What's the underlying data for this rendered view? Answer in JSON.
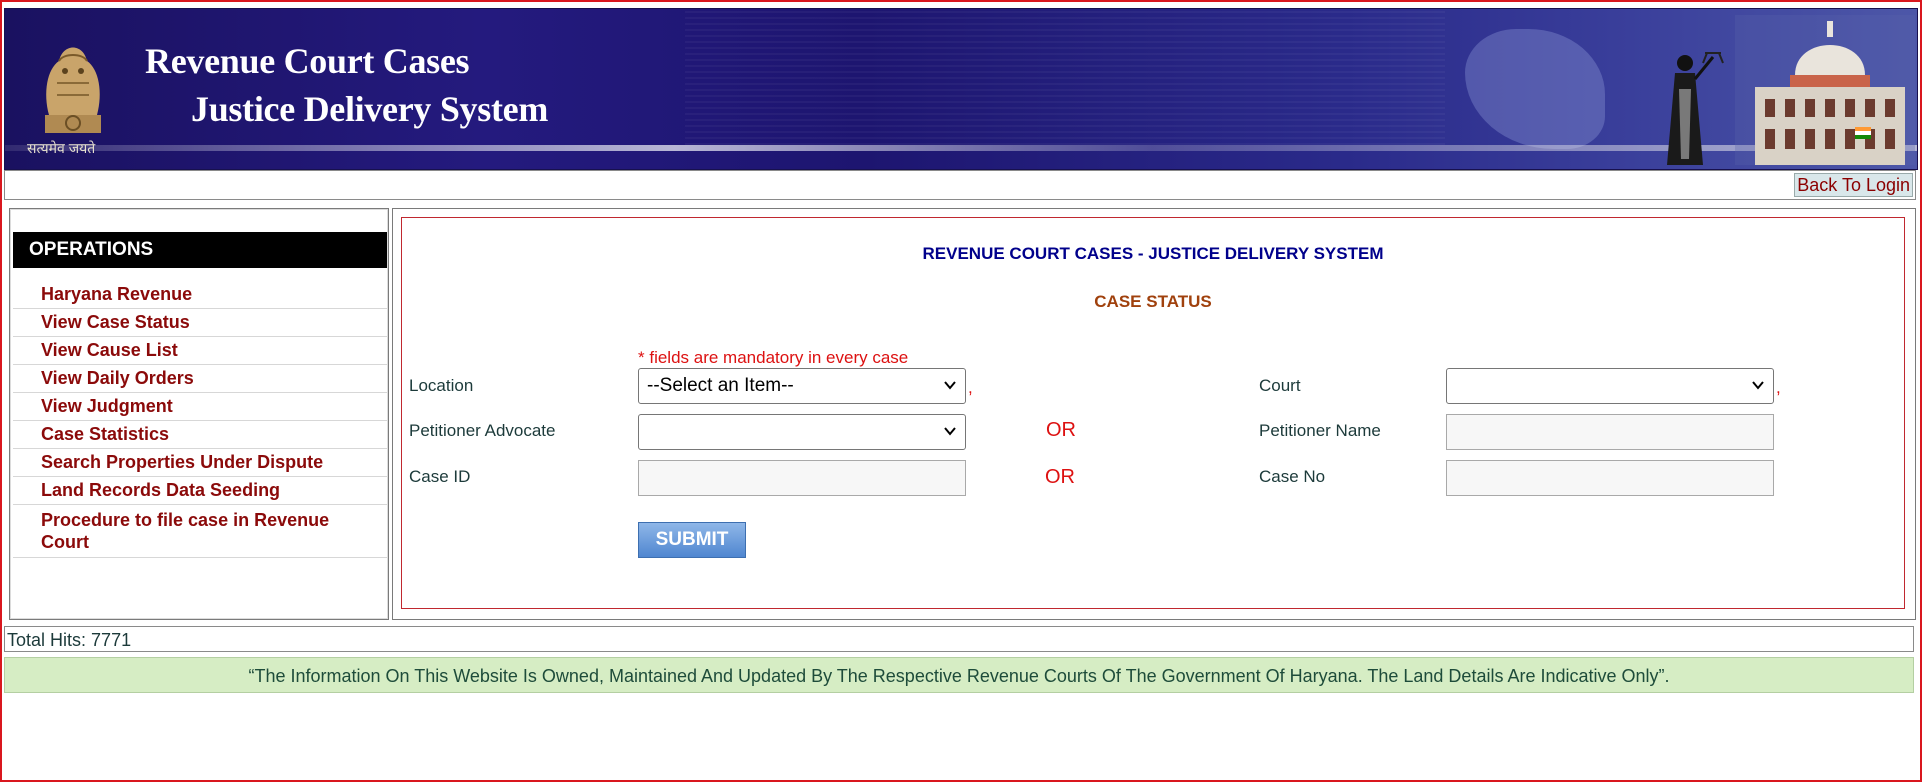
{
  "banner": {
    "title_line1": "Revenue Court Cases",
    "title_line2": "Justice Delivery System",
    "emblem_caption": "सत्यमेव जयते",
    "icons": [
      "national-emblem-icon",
      "justice-statue-icon",
      "court-building-icon"
    ]
  },
  "topbar": {
    "back_to_login": "Back To Login"
  },
  "sidebar": {
    "title": "OPERATIONS",
    "items": [
      "Haryana Revenue",
      "View Case Status",
      "View Cause List",
      "View Daily Orders",
      "View Judgment",
      "Case Statistics",
      "Search Properties Under Dispute",
      "Land Records Data Seeding",
      "Procedure to file case in Revenue Court"
    ]
  },
  "main": {
    "system_title": "REVENUE COURT CASES - JUSTICE DELIVERY SYSTEM",
    "page_title": "CASE STATUS",
    "mandatory_asterisk": "*",
    "mandatory_note": " fields are mandatory in every case",
    "form": {
      "location_label": "Location",
      "location_value": "--Select an Item--",
      "court_label": "Court",
      "court_value": "",
      "petitioner_advocate_label": "Petitioner Advocate",
      "petitioner_advocate_value": "",
      "petitioner_name_label": "Petitioner Name",
      "petitioner_name_value": "",
      "case_id_label": "Case ID",
      "case_id_value": "",
      "case_no_label": "Case No",
      "case_no_value": "",
      "comma": ",",
      "or_label": "OR",
      "submit_label": "SUBMIT"
    }
  },
  "footer": {
    "total_hits_label": "Total Hits:",
    "total_hits_value": "7771",
    "disclaimer": "“The Information On This Website Is Owned, Maintained And Updated By The Respective Revenue Courts Of The Government Of Haryana. The Land Details Are Indicative Only”."
  },
  "colors": {
    "banner_bg": "#1d1570",
    "nav_link": "#8b0a0a",
    "system_title": "#00008b",
    "case_status": "#a0410d",
    "error_red": "#dd1111",
    "disclaimer_bg": "#d6edc4",
    "submit_bg": "#4f86d0"
  }
}
